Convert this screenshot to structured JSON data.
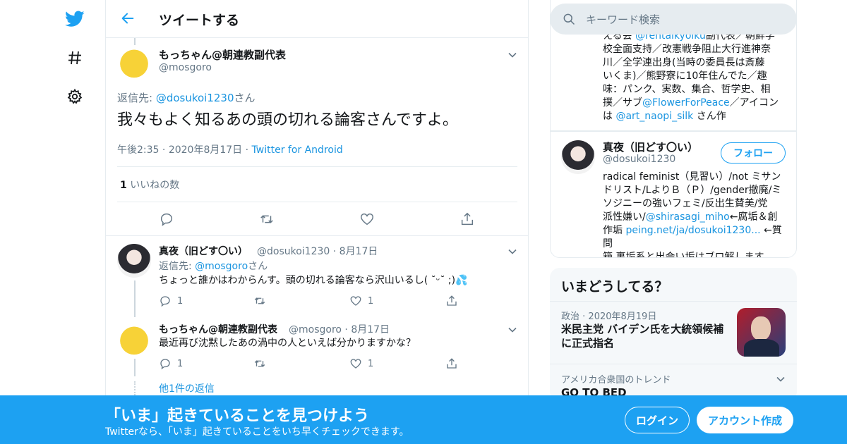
{
  "header": {
    "title": "ツイートする"
  },
  "main_tweet": {
    "author_name": "もっちゃん@朝連教副代表",
    "author_handle": "@mosgoro",
    "reply_prefix": "返信先: ",
    "reply_handle": "@dosukoi1230",
    "reply_suffix": "さん",
    "text": "我々もよく知るあの頭の切れる論客さんですよ。",
    "time": "午後2:35",
    "date": "2020年8月17日",
    "source": "Twitter for Android",
    "like_count": "1",
    "like_label": "いいねの数"
  },
  "replies": [
    {
      "name": "真夜（旧どす〇い）",
      "handle": "@dosukoi1230",
      "date": "8月17日",
      "reply_prefix": "返信先: ",
      "reply_handle": "@mosgoro",
      "reply_suffix": "さん",
      "text": "ちょっと誰かはわからんす。頭の切れる論客なら沢山いるし( ˘ᵕ˘ ;)💦",
      "reply_count": "1",
      "like_count": "1"
    },
    {
      "name": "もっちゃん@朝連教副代表",
      "handle": "@mosgoro",
      "date": "8月17日",
      "text": "最近再び沈黙したあの渦中の人といえば分かりますかな？",
      "reply_count": "1",
      "like_count": "1"
    }
  ],
  "more_replies": "他1件の返信",
  "search": {
    "placeholder": "キーワード検索"
  },
  "bio_card": {
    "line1_pre": "える会 ",
    "line1_link": "@rentaikyoiku",
    "line1_post": "副代表／朝鮮学",
    "line2": "校全面支持／改憲戦争阻止大行進神奈",
    "line3": "川／全学連出身(当時の委員長は斎藤",
    "line4": "いくま)／熊野寮に10年住んでた／趣",
    "line5": "味：パンク、実数、集合、哲学史、相",
    "line6_pre": "撲／サブ",
    "line6_link": "@FlowerForPeace",
    "line6_post": "／アイコン",
    "line7_pre": "は ",
    "line7_link": "@art_naopi_silk",
    "line7_post": " さん作"
  },
  "profile_card": {
    "name": "真夜（旧どす〇い）",
    "handle": "@dosukoi1230",
    "follow_label": "フォロー",
    "bio1": "radical feminist（見習い）/not ミサン",
    "bio2": "ドリスト/LよりＢ（Ｐ）/gender撤廃/ミ",
    "bio3": "ソジニーの強いフェミ/反出生賛美/党",
    "bio4_pre": "派性嫌い/",
    "bio4_link": "@shirasagi_miho",
    "bio4_post": "←腐垢＆創",
    "bio5_pre": "作垢 ",
    "bio5_link": "peing.net/ja/dosukoi1230...",
    "bio5_post": " ←質問",
    "bio6": "箱 裏垢系と出会い垢はブロ解します"
  },
  "trends": {
    "title": "いまどうしてる？",
    "news_category": "政治",
    "news_date": "2020年8月19日",
    "news_title_1": "米民主党 バイデン氏を大統領候補",
    "news_title_2": "に正式指名",
    "trend_location": "アメリカ合衆国のトレンド",
    "trend_name": "GO TO BED"
  },
  "banner": {
    "title": "「いま」起きていることを見つけよう",
    "subtitle": "Twitterなら、「いま」起きていることをいち早くチェックできます。",
    "login": "ログイン",
    "signup": "アカウント作成"
  },
  "colors": {
    "accent": "#1da1f2",
    "link": "#1b95e0",
    "muted": "#657786"
  }
}
